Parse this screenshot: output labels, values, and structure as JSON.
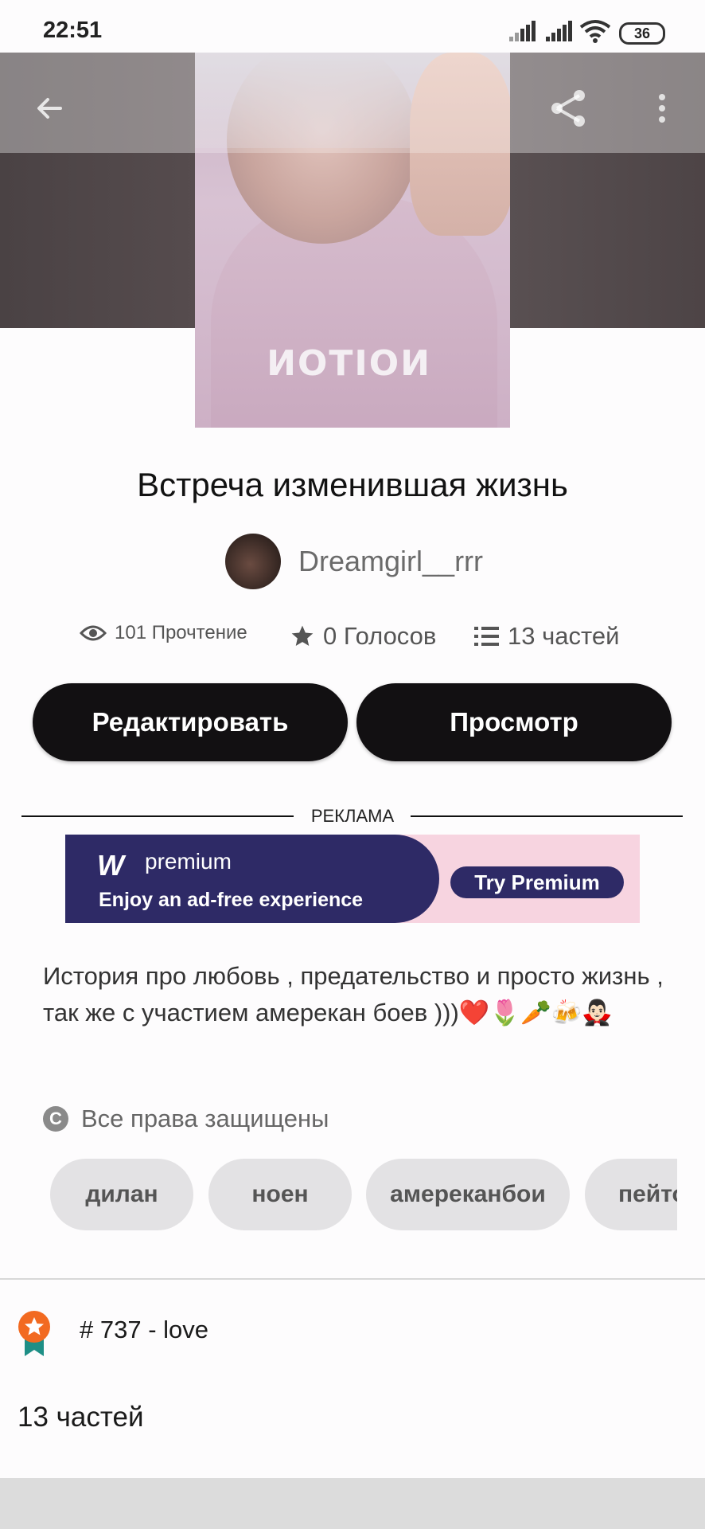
{
  "status_bar": {
    "time": "22:51",
    "battery": "36"
  },
  "story": {
    "title": "Встреча изменившая жизнь",
    "author": "Dreamgirl__rrr",
    "cover_print": "NOITON"
  },
  "stats": {
    "reads": "101 Прочтение",
    "votes": "0 Голосов",
    "parts": "13 частей"
  },
  "buttons": {
    "edit": "Редактировать",
    "preview": "Просмотр"
  },
  "ad": {
    "label": "РЕКЛАМА",
    "brand": "premium",
    "logo": "W",
    "tagline": "Enjoy an ad-free experience",
    "cta": "Try Premium"
  },
  "description": "История про любовь , предательство и просто жизнь , так же с участием амерекан боев )))❤️🌷🥕🍻🧛🏻‍♂️",
  "copyright": "Все права защищены",
  "tags": [
    "дилан",
    "ноен",
    "амереканбои",
    "пейтон"
  ],
  "ranking": "# 737 - love",
  "parts_heading": "13 частей",
  "colors": {
    "button_bg": "#121012",
    "ad_navy": "#2e2a66",
    "ad_pink": "#f7d4e0",
    "badge_orange": "#f26a21"
  }
}
